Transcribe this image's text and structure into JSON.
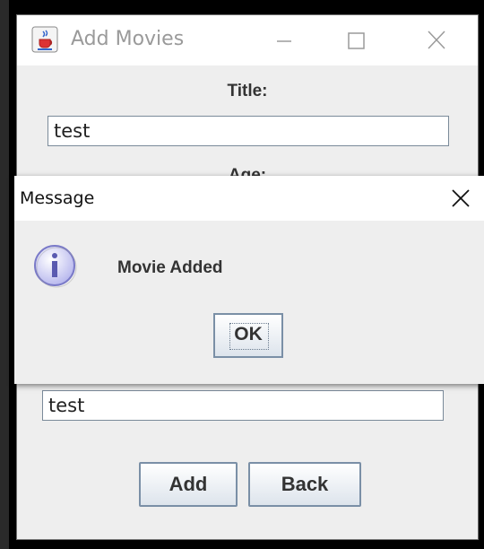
{
  "window": {
    "title": "Add Movies",
    "title_label": "Title:",
    "title_value": "test",
    "age_label": "Age:",
    "second_value": "test",
    "add_label": "Add",
    "back_label": "Back"
  },
  "dialog": {
    "title": "Message",
    "message": "Movie Added",
    "ok_label": "OK"
  },
  "icons": {
    "app": "java-cup-icon",
    "minimize": "minimize-icon",
    "maximize": "maximize-icon",
    "close": "close-icon",
    "info": "info-icon"
  },
  "colors": {
    "info_icon_fill": "#c9c9f2",
    "button_border": "#7a8fa6"
  }
}
